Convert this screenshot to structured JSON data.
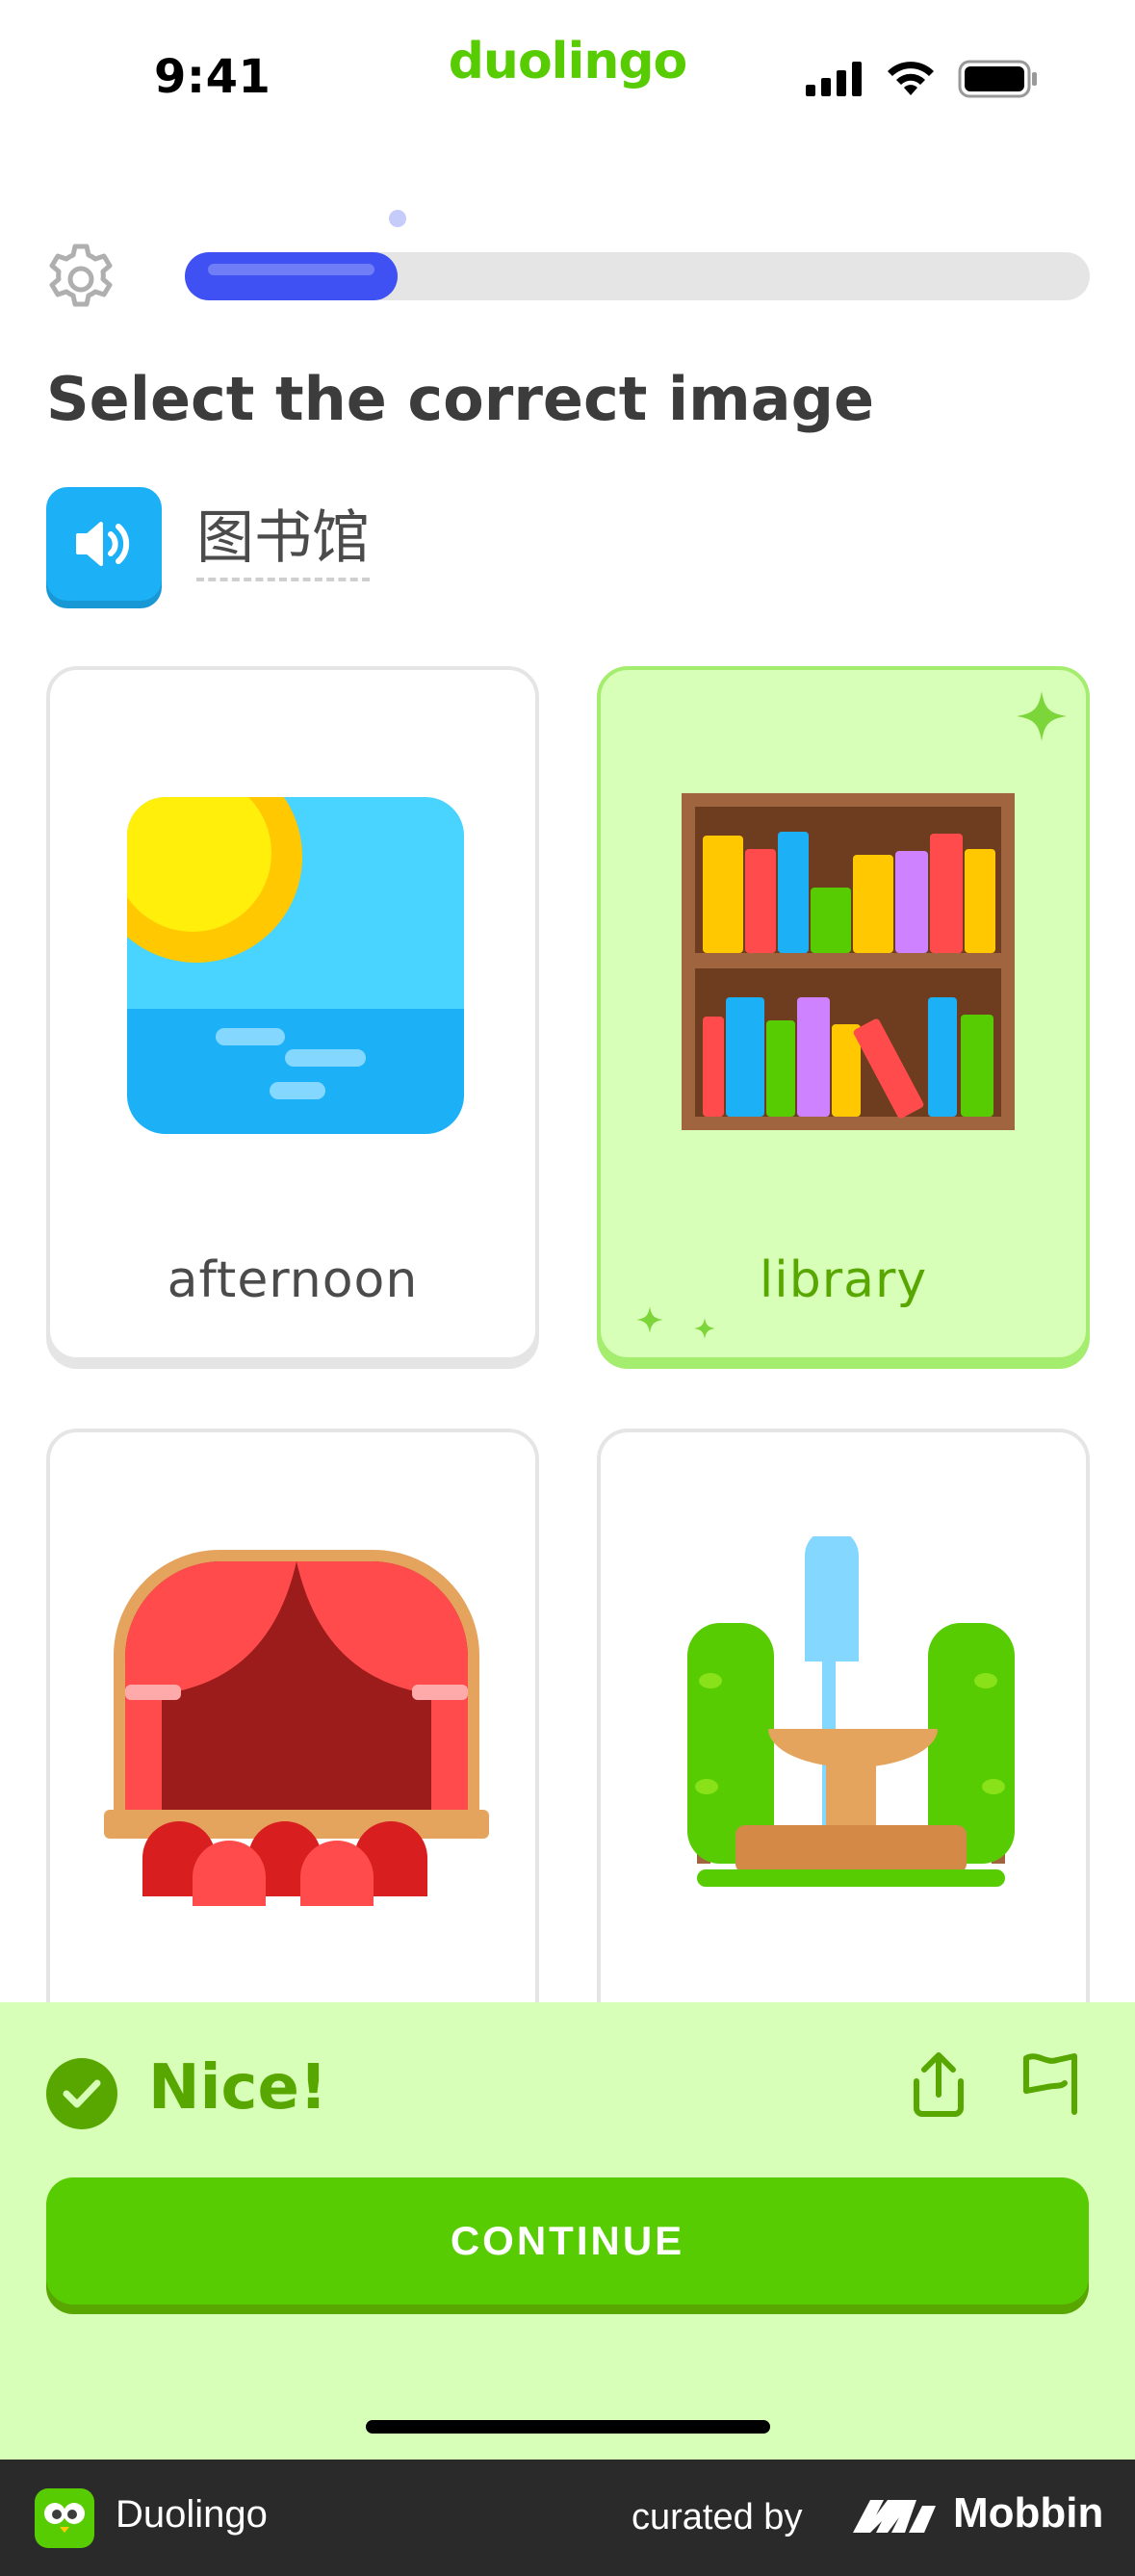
{
  "status_bar": {
    "time": "9:41",
    "brand": "duolingo"
  },
  "progress": {
    "fraction": 0.235
  },
  "lesson": {
    "title": "Select the correct image",
    "prompt": "图书馆"
  },
  "cards": [
    {
      "label": "afternoon",
      "selected": false,
      "icon": "sun-over-sea-icon"
    },
    {
      "label": "library",
      "selected": true,
      "icon": "bookshelf-icon"
    },
    {
      "label": "",
      "selected": false,
      "icon": "theater-stage-icon"
    },
    {
      "label": "",
      "selected": false,
      "icon": "park-fountain-icon"
    }
  ],
  "feedback": {
    "message": "Nice!",
    "continue_label": "CONTINUE"
  },
  "footer": {
    "app_name": "Duolingo",
    "curated_by": "curated by",
    "curator": "Mobbin"
  },
  "colors": {
    "brand_green": "#58cc02",
    "progress_blue": "#3f51f2",
    "correct_bg": "#d7ffb8",
    "correct_text": "#58a700"
  }
}
